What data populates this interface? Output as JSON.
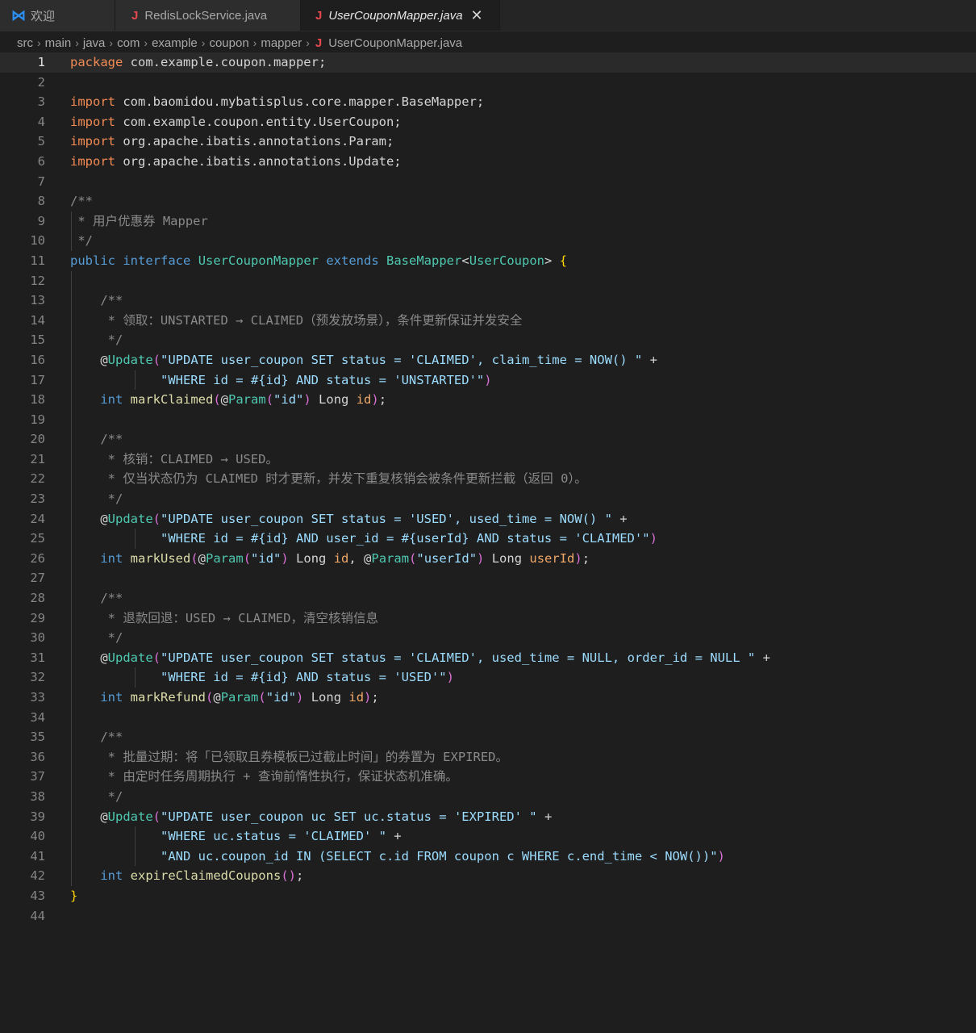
{
  "tabs": [
    {
      "label": "欢迎",
      "icon": "vscode-icon"
    },
    {
      "label": "RedisLockService.java",
      "icon": "java-file-icon"
    },
    {
      "label": "UserCouponMapper.java",
      "icon": "java-file-icon",
      "active": true
    }
  ],
  "breadcrumb": [
    "src",
    "main",
    "java",
    "com",
    "example",
    "coupon",
    "mapper",
    "UserCouponMapper.java"
  ],
  "editor": {
    "current_line": 1,
    "lines": [
      [
        [
          "kwo",
          "package"
        ],
        [
          "plain",
          " com.example.coupon.mapper;"
        ]
      ],
      [],
      [
        [
          "kwo",
          "import"
        ],
        [
          "plain",
          " com.baomidou.mybatisplus.core.mapper.BaseMapper;"
        ]
      ],
      [
        [
          "kwo",
          "import"
        ],
        [
          "plain",
          " com.example.coupon.entity.UserCoupon;"
        ]
      ],
      [
        [
          "kwo",
          "import"
        ],
        [
          "plain",
          " org.apache.ibatis.annotations.Param;"
        ]
      ],
      [
        [
          "kwo",
          "import"
        ],
        [
          "plain",
          " org.apache.ibatis.annotations.Update;"
        ]
      ],
      [],
      [
        [
          "com",
          "/**"
        ]
      ],
      [
        [
          "com",
          " * 用户优惠券 Mapper"
        ]
      ],
      [
        [
          "com",
          " */"
        ]
      ],
      [
        [
          "kwb",
          "public"
        ],
        [
          "plain",
          " "
        ],
        [
          "kwb",
          "interface"
        ],
        [
          "plain",
          " "
        ],
        [
          "ty",
          "UserCouponMapper"
        ],
        [
          "plain",
          " "
        ],
        [
          "kwb",
          "extends"
        ],
        [
          "plain",
          " "
        ],
        [
          "ty",
          "BaseMapper"
        ],
        [
          "plain",
          "<"
        ],
        [
          "ty",
          "UserCoupon"
        ],
        [
          "plain",
          "> "
        ],
        [
          "br",
          "{"
        ]
      ],
      [],
      [
        [
          "plain",
          "    "
        ],
        [
          "com",
          "/**"
        ]
      ],
      [
        [
          "plain",
          "    "
        ],
        [
          "com",
          " * 领取：UNSTARTED → CLAIMED（预发放场景），条件更新保证并发安全"
        ]
      ],
      [
        [
          "plain",
          "    "
        ],
        [
          "com",
          " */"
        ]
      ],
      [
        [
          "plain",
          "    @"
        ],
        [
          "ann",
          "Update"
        ],
        [
          "pr",
          "("
        ],
        [
          "str",
          "\"UPDATE user_coupon SET status = 'CLAIMED', claim_time = NOW() \""
        ],
        [
          "plain",
          " +"
        ]
      ],
      [
        [
          "plain",
          "            "
        ],
        [
          "str",
          "\"WHERE id = #{id} AND status = 'UNSTARTED'\""
        ],
        [
          "pr",
          ")"
        ]
      ],
      [
        [
          "plain",
          "    "
        ],
        [
          "kwb",
          "int"
        ],
        [
          "plain",
          " "
        ],
        [
          "fn",
          "markClaimed"
        ],
        [
          "pr",
          "("
        ],
        [
          "plain",
          "@"
        ],
        [
          "ann",
          "Param"
        ],
        [
          "pr",
          "("
        ],
        [
          "str",
          "\"id\""
        ],
        [
          "pr",
          ")"
        ],
        [
          "plain",
          " Long "
        ],
        [
          "par",
          "id"
        ],
        [
          "pr",
          ")"
        ],
        [
          "plain",
          ";"
        ]
      ],
      [],
      [
        [
          "plain",
          "    "
        ],
        [
          "com",
          "/**"
        ]
      ],
      [
        [
          "plain",
          "    "
        ],
        [
          "com",
          " * 核销：CLAIMED → USED。"
        ]
      ],
      [
        [
          "plain",
          "    "
        ],
        [
          "com",
          " * 仅当状态仍为 CLAIMED 时才更新，并发下重复核销会被条件更新拦截（返回 0）。"
        ]
      ],
      [
        [
          "plain",
          "    "
        ],
        [
          "com",
          " */"
        ]
      ],
      [
        [
          "plain",
          "    @"
        ],
        [
          "ann",
          "Update"
        ],
        [
          "pr",
          "("
        ],
        [
          "str",
          "\"UPDATE user_coupon SET status = 'USED', used_time = NOW() \""
        ],
        [
          "plain",
          " +"
        ]
      ],
      [
        [
          "plain",
          "            "
        ],
        [
          "str",
          "\"WHERE id = #{id} AND user_id = #{userId} AND status = 'CLAIMED'\""
        ],
        [
          "pr",
          ")"
        ]
      ],
      [
        [
          "plain",
          "    "
        ],
        [
          "kwb",
          "int"
        ],
        [
          "plain",
          " "
        ],
        [
          "fn",
          "markUsed"
        ],
        [
          "pr",
          "("
        ],
        [
          "plain",
          "@"
        ],
        [
          "ann",
          "Param"
        ],
        [
          "pr",
          "("
        ],
        [
          "str",
          "\"id\""
        ],
        [
          "pr",
          ")"
        ],
        [
          "plain",
          " Long "
        ],
        [
          "par",
          "id"
        ],
        [
          "plain",
          ", @"
        ],
        [
          "ann",
          "Param"
        ],
        [
          "pr",
          "("
        ],
        [
          "str",
          "\"userId\""
        ],
        [
          "pr",
          ")"
        ],
        [
          "plain",
          " Long "
        ],
        [
          "par",
          "userId"
        ],
        [
          "pr",
          ")"
        ],
        [
          "plain",
          ";"
        ]
      ],
      [],
      [
        [
          "plain",
          "    "
        ],
        [
          "com",
          "/**"
        ]
      ],
      [
        [
          "plain",
          "    "
        ],
        [
          "com",
          " * 退款回退：USED → CLAIMED，清空核销信息"
        ]
      ],
      [
        [
          "plain",
          "    "
        ],
        [
          "com",
          " */"
        ]
      ],
      [
        [
          "plain",
          "    @"
        ],
        [
          "ann",
          "Update"
        ],
        [
          "pr",
          "("
        ],
        [
          "str",
          "\"UPDATE user_coupon SET status = 'CLAIMED', used_time = NULL, order_id = NULL \""
        ],
        [
          "plain",
          " +"
        ]
      ],
      [
        [
          "plain",
          "            "
        ],
        [
          "str",
          "\"WHERE id = #{id} AND status = 'USED'\""
        ],
        [
          "pr",
          ")"
        ]
      ],
      [
        [
          "plain",
          "    "
        ],
        [
          "kwb",
          "int"
        ],
        [
          "plain",
          " "
        ],
        [
          "fn",
          "markRefund"
        ],
        [
          "pr",
          "("
        ],
        [
          "plain",
          "@"
        ],
        [
          "ann",
          "Param"
        ],
        [
          "pr",
          "("
        ],
        [
          "str",
          "\"id\""
        ],
        [
          "pr",
          ")"
        ],
        [
          "plain",
          " Long "
        ],
        [
          "par",
          "id"
        ],
        [
          "pr",
          ")"
        ],
        [
          "plain",
          ";"
        ]
      ],
      [],
      [
        [
          "plain",
          "    "
        ],
        [
          "com",
          "/**"
        ]
      ],
      [
        [
          "plain",
          "    "
        ],
        [
          "com",
          " * 批量过期：将「已领取且券模板已过截止时间」的券置为 EXPIRED。"
        ]
      ],
      [
        [
          "plain",
          "    "
        ],
        [
          "com",
          " * 由定时任务周期执行 + 查询前惰性执行，保证状态机准确。"
        ]
      ],
      [
        [
          "plain",
          "    "
        ],
        [
          "com",
          " */"
        ]
      ],
      [
        [
          "plain",
          "    @"
        ],
        [
          "ann",
          "Update"
        ],
        [
          "pr",
          "("
        ],
        [
          "str",
          "\"UPDATE user_coupon uc SET uc.status = 'EXPIRED' \""
        ],
        [
          "plain",
          " +"
        ]
      ],
      [
        [
          "plain",
          "            "
        ],
        [
          "str",
          "\"WHERE uc.status = 'CLAIMED' \""
        ],
        [
          "plain",
          " +"
        ]
      ],
      [
        [
          "plain",
          "            "
        ],
        [
          "str",
          "\"AND uc.coupon_id IN (SELECT c.id FROM coupon c WHERE c.end_time < NOW())\""
        ],
        [
          "pr",
          ")"
        ]
      ],
      [
        [
          "plain",
          "    "
        ],
        [
          "kwb",
          "int"
        ],
        [
          "plain",
          " "
        ],
        [
          "fn",
          "expireClaimedCoupons"
        ],
        [
          "pr",
          "()"
        ],
        [
          "plain",
          ";"
        ]
      ],
      [
        [
          "br",
          "}"
        ]
      ],
      []
    ]
  },
  "colors": {
    "background": "#1e1e1e",
    "tab_bar": "#252526",
    "keyword_orange": "#f28b54",
    "keyword_blue": "#569cd6",
    "type": "#4ec9b0",
    "string": "#9cdcfe",
    "comment": "#8a8a8a",
    "java_icon": "#e5484d"
  }
}
